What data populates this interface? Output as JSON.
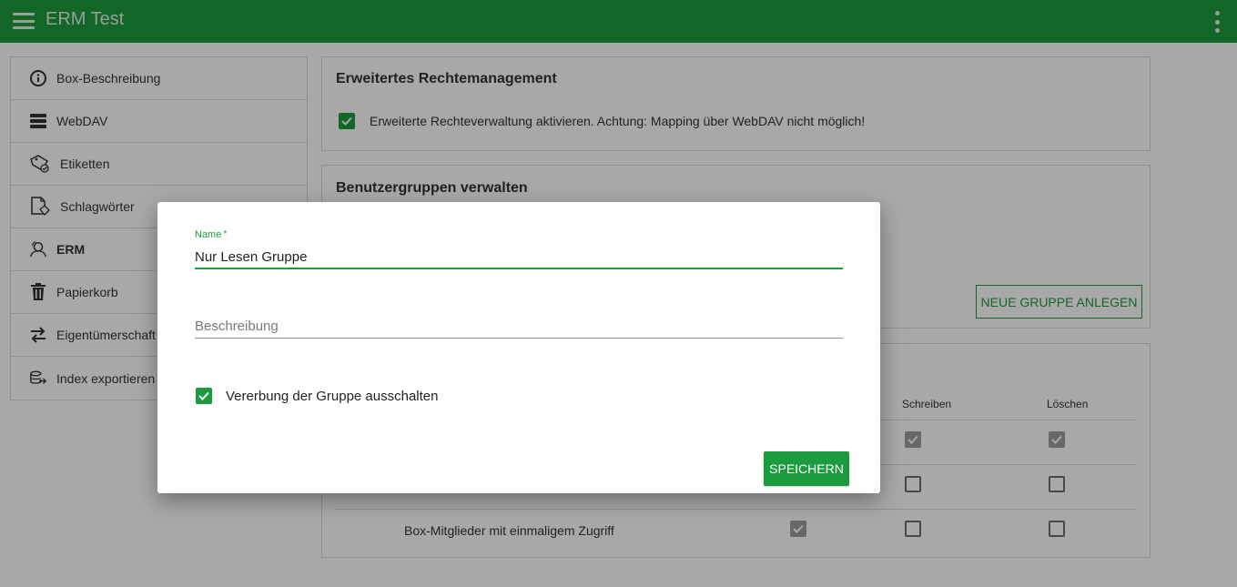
{
  "header": {
    "title": "ERM Test",
    "menu_icon": "hamburger-icon",
    "more_icon": "kebab-icon"
  },
  "sidebar": {
    "items": [
      {
        "label": "Box-Beschreibung",
        "icon": "info-icon"
      },
      {
        "label": "WebDAV",
        "icon": "server-stack-icon"
      },
      {
        "label": "Etiketten",
        "icon": "tag-icon"
      },
      {
        "label": "Schlagwörter",
        "icon": "document-tag-icon"
      },
      {
        "label": "ERM",
        "icon": "users-icon",
        "active": true
      },
      {
        "label": "Papierkorb",
        "icon": "trash-icon"
      },
      {
        "label": "Eigentümerschaft",
        "icon": "swap-arrows-icon"
      },
      {
        "label": "Index exportieren",
        "icon": "database-export-icon"
      }
    ]
  },
  "erm_card": {
    "title": "Erweitertes Rechtemanagement",
    "checkbox_label": "Erweiterte Rechteverwaltung aktivieren. Achtung: Mapping über WebDAV nicht möglich!",
    "checked": true
  },
  "groups_card": {
    "title": "Benutzergruppen verwalten",
    "new_group_button": "NEUE GRUPPE ANLEGEN"
  },
  "permissions_table": {
    "columns": [
      "Schreiben",
      "Löschen"
    ],
    "rows": [
      {
        "label": "",
        "read": null,
        "write": "grey",
        "delete": "grey"
      },
      {
        "label": "",
        "read": null,
        "write": "empty",
        "delete": "empty"
      },
      {
        "label": "Box-Mitglieder mit einmaligem Zugriff",
        "read": "grey",
        "write": "empty",
        "delete": "empty"
      }
    ]
  },
  "modal": {
    "name_label": "Name",
    "required_mark": "*",
    "name_value": "Nur Lesen Gruppe",
    "description_placeholder": "Beschreibung",
    "inherit_label": "Vererbung der Gruppe ausschalten",
    "inherit_checked": true,
    "save_button": "SPEICHERN"
  },
  "colors": {
    "brand": "#1a9b3e",
    "overlay": "rgba(0,0,0,0.34)"
  }
}
